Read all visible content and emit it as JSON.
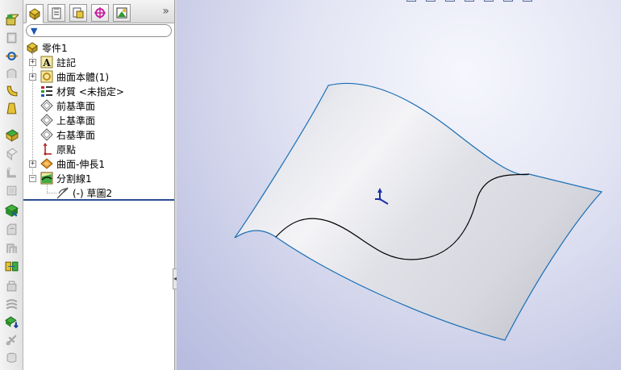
{
  "toolbar": {
    "commands": [
      "extruded-boss-icon",
      "revolved-boss-icon",
      "swept-boss-icon",
      "lofted-boss-icon",
      "fillet-icon",
      "rib-icon",
      "extruded-surface-icon",
      "revolved-surface-icon",
      "swept-surface-icon",
      "lofted-surface-icon",
      "offset-surface-icon",
      "planar-surface-icon",
      "split-line-icon",
      "projected-curve-icon",
      "helix-icon",
      "thicken-icon",
      "knit-surface-icon",
      "trim-surface-icon",
      "move-face-icon",
      "cut-with-surface-icon",
      "delete-face-icon",
      "instant3d-icon"
    ]
  },
  "panel_tabs": [
    "feature-manager-icon",
    "property-manager-icon",
    "configuration-manager-icon",
    "dimxpert-icon",
    "display-manager-icon"
  ],
  "more_symbol": "»",
  "tree": {
    "root": "零件1",
    "items": [
      {
        "label": "註記",
        "icon": "annotations-icon",
        "expander": "+"
      },
      {
        "label": "曲面本體(1)",
        "icon": "surface-bodies-icon",
        "expander": "+"
      },
      {
        "label": "材質 <未指定>",
        "icon": "material-icon",
        "expander": ""
      },
      {
        "label": "前基準面",
        "icon": "plane-icon",
        "expander": ""
      },
      {
        "label": "上基準面",
        "icon": "plane-icon",
        "expander": ""
      },
      {
        "label": "右基準面",
        "icon": "plane-icon",
        "expander": ""
      },
      {
        "label": "原點",
        "icon": "origin-icon",
        "expander": ""
      },
      {
        "label": "曲面-伸長1",
        "icon": "surface-extrude-icon",
        "expander": "+"
      },
      {
        "label": "分割線1",
        "icon": "split-line-icon",
        "expander": "−"
      },
      {
        "label": "(-) 草圖2",
        "icon": "sketch-icon",
        "expander": ""
      }
    ]
  },
  "colors": {
    "surface_edge": "#1c6fb5",
    "split_line": "#000000",
    "rollback_bar": "#2a4f93"
  }
}
